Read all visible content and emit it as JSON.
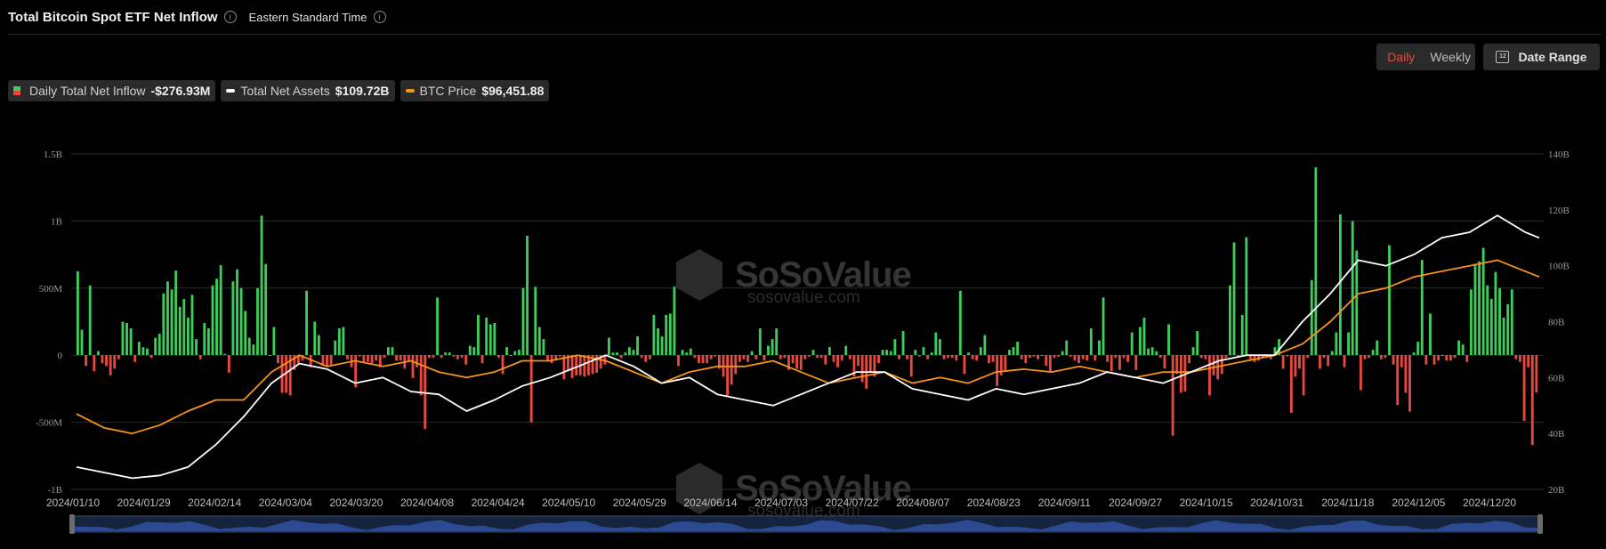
{
  "header": {
    "title": "Total Bitcoin Spot ETF Net Inflow",
    "timezone": "Eastern Standard Time",
    "period_toggle": {
      "daily": "Daily",
      "weekly": "Weekly",
      "selected": "Daily"
    },
    "date_range_label": "Date Range"
  },
  "legend": [
    {
      "label": "Daily Total Net Inflow",
      "value": "-$276.93M"
    },
    {
      "label": "Total Net Assets",
      "value": "$109.72B"
    },
    {
      "label": "BTC Price",
      "value": "$96,451.88"
    }
  ],
  "watermark": {
    "name": "SoSoValue",
    "url": "sosovalue.com"
  },
  "colors": {
    "inflow_positive": "#3ccd5a",
    "inflow_negative": "#e8483e",
    "net_assets": "#ffffff",
    "btc_price": "#f7931a",
    "grid": "#2b2b2b"
  },
  "chart_data": {
    "type": "bar",
    "x_tick_labels": [
      "2024/01/10",
      "2024/01/29",
      "2024/02/14",
      "2024/03/04",
      "2024/03/20",
      "2024/04/08",
      "2024/04/24",
      "2024/05/10",
      "2024/05/29",
      "2024/06/14",
      "2024/07/03",
      "2024/07/22",
      "2024/08/07",
      "2024/08/23",
      "2024/09/11",
      "2024/09/27",
      "2024/10/15",
      "2024/10/31",
      "2024/11/18",
      "2024/12/05",
      "2024/12/20"
    ],
    "y_left": {
      "ticks": [
        "1.5B",
        "1B",
        "500M",
        "0",
        "-500M",
        "-1B"
      ],
      "range": [
        -1000000000,
        1500000000
      ]
    },
    "y_right": {
      "ticks": [
        "140B",
        "120B",
        "100B",
        "80B",
        "60B",
        "40B",
        "20B"
      ],
      "range": [
        20,
        140
      ]
    },
    "series": [
      {
        "name": "Daily Total Net Inflow",
        "kind": "bar",
        "unit": "USD (millions)",
        "values": [
          625,
          190,
          -80,
          520,
          -120,
          30,
          -60,
          -80,
          -150,
          -100,
          -30,
          250,
          240,
          200,
          -50,
          100,
          60,
          50,
          -20,
          130,
          160,
          460,
          550,
          490,
          630,
          360,
          420,
          280,
          450,
          120,
          -30,
          240,
          200,
          520,
          570,
          670,
          10,
          -130,
          550,
          640,
          500,
          330,
          130,
          80,
          500,
          1040,
          680,
          0,
          210,
          -60,
          -280,
          -280,
          -300,
          -110,
          -60,
          -40,
          480,
          -90,
          250,
          150,
          -80,
          -80,
          -70,
          110,
          200,
          210,
          -30,
          -90,
          -240,
          -10,
          -50,
          -50,
          -60,
          -40,
          -90,
          -20,
          60,
          60,
          -40,
          -40,
          -100,
          -40,
          -170,
          -90,
          -300,
          -550,
          -20,
          -20,
          430,
          -20,
          20,
          20,
          -10,
          -30,
          -20,
          -70,
          70,
          60,
          300,
          -60,
          280,
          230,
          240,
          -20,
          -140,
          60,
          0,
          30,
          40,
          500,
          890,
          -500,
          510,
          210,
          120,
          -40,
          -60,
          -30,
          -10,
          -180,
          -120,
          -170,
          -150,
          -150,
          -160,
          -150,
          -140,
          -130,
          -100,
          -70,
          130,
          20,
          20,
          -20,
          20,
          60,
          40,
          140,
          -20,
          -50,
          -30,
          300,
          200,
          140,
          300,
          310,
          510,
          -80,
          40,
          20,
          50,
          -20,
          -60,
          -60,
          -60,
          -30,
          -10,
          -100,
          -160,
          -300,
          -220,
          -140,
          -50,
          -30,
          -50,
          30,
          -30,
          200,
          -40,
          70,
          120,
          200,
          -30,
          -20,
          -110,
          -60,
          -100,
          -110,
          -30,
          -10,
          40,
          -20,
          -20,
          -70,
          60,
          -50,
          -90,
          -40,
          70,
          -30,
          -160,
          -80,
          -200,
          -250,
          -130,
          -160,
          -60,
          40,
          40,
          30,
          120,
          -30,
          180,
          -30,
          -160,
          40,
          -10,
          60,
          -30,
          20,
          170,
          120,
          -30,
          -20,
          -20,
          -40,
          480,
          -140,
          20,
          -30,
          -40,
          60,
          150,
          -60,
          -50,
          -230,
          -150,
          -120,
          40,
          60,
          100,
          -30,
          -60,
          -20,
          -10,
          -30,
          0,
          -80,
          -120,
          -20,
          -10,
          30,
          110,
          -10,
          -40,
          -60,
          -30,
          -40,
          200,
          -40,
          110,
          430,
          -50,
          -120,
          -20,
          -110,
          -20,
          -50,
          170,
          -110,
          210,
          280,
          50,
          60,
          30,
          -20,
          -100,
          230,
          -600,
          -140,
          -280,
          -270,
          -60,
          60,
          180,
          -20,
          -30,
          -300,
          -150,
          -180,
          -140,
          -20,
          520,
          840,
          -10,
          300,
          880,
          -30,
          -50,
          -40,
          -20,
          -20,
          -30,
          60,
          120,
          -100,
          -10,
          -430,
          -160,
          -100,
          -300,
          -20,
          560,
          1400,
          -100,
          -20,
          -80,
          30,
          170,
          1050,
          -90,
          170,
          1000,
          780,
          -260,
          -30,
          -20,
          40,
          110,
          -30,
          -20,
          820,
          -70,
          -370,
          -90,
          -280,
          -420,
          20,
          100,
          710,
          -70,
          310,
          -70,
          -40,
          0,
          -40,
          -40,
          -20,
          110,
          80,
          -50,
          490,
          680,
          700,
          800,
          520,
          420,
          620,
          500,
          280,
          380,
          490,
          -30,
          -50,
          -490,
          -90,
          -670,
          -277
        ]
      },
      {
        "name": "Total Net Assets",
        "kind": "line",
        "unit": "USD (billions)",
        "points": [
          [
            0,
            28
          ],
          [
            6,
            26
          ],
          [
            12,
            24
          ],
          [
            18,
            25
          ],
          [
            24,
            28
          ],
          [
            30,
            36
          ],
          [
            36,
            46
          ],
          [
            42,
            58
          ],
          [
            48,
            65
          ],
          [
            54,
            63
          ],
          [
            60,
            58
          ],
          [
            66,
            60
          ],
          [
            72,
            55
          ],
          [
            78,
            54
          ],
          [
            84,
            48
          ],
          [
            90,
            52
          ],
          [
            96,
            57
          ],
          [
            102,
            60
          ],
          [
            108,
            64
          ],
          [
            114,
            68
          ],
          [
            120,
            64
          ],
          [
            126,
            58
          ],
          [
            132,
            60
          ],
          [
            138,
            54
          ],
          [
            144,
            52
          ],
          [
            150,
            50
          ],
          [
            156,
            54
          ],
          [
            162,
            58
          ],
          [
            168,
            62
          ],
          [
            174,
            62
          ],
          [
            180,
            56
          ],
          [
            186,
            54
          ],
          [
            192,
            52
          ],
          [
            198,
            56
          ],
          [
            204,
            54
          ],
          [
            210,
            56
          ],
          [
            216,
            58
          ],
          [
            222,
            62
          ],
          [
            228,
            60
          ],
          [
            234,
            58
          ],
          [
            240,
            62
          ],
          [
            246,
            66
          ],
          [
            252,
            68
          ],
          [
            258,
            68
          ],
          [
            264,
            80
          ],
          [
            270,
            90
          ],
          [
            276,
            102
          ],
          [
            282,
            100
          ],
          [
            288,
            104
          ],
          [
            294,
            110
          ],
          [
            300,
            112
          ],
          [
            306,
            118
          ],
          [
            312,
            112
          ],
          [
            315,
            110
          ]
        ]
      },
      {
        "name": "BTC Price",
        "kind": "line",
        "unit": "USD (thousands)",
        "points": [
          [
            0,
            47
          ],
          [
            6,
            42
          ],
          [
            12,
            40
          ],
          [
            18,
            43
          ],
          [
            24,
            48
          ],
          [
            30,
            52
          ],
          [
            36,
            52
          ],
          [
            42,
            62
          ],
          [
            48,
            68
          ],
          [
            54,
            64
          ],
          [
            60,
            66
          ],
          [
            66,
            64
          ],
          [
            72,
            66
          ],
          [
            78,
            62
          ],
          [
            84,
            60
          ],
          [
            90,
            62
          ],
          [
            96,
            66
          ],
          [
            102,
            66
          ],
          [
            108,
            68
          ],
          [
            114,
            66
          ],
          [
            120,
            62
          ],
          [
            126,
            58
          ],
          [
            132,
            62
          ],
          [
            138,
            64
          ],
          [
            144,
            64
          ],
          [
            150,
            66
          ],
          [
            156,
            62
          ],
          [
            162,
            58
          ],
          [
            168,
            60
          ],
          [
            174,
            62
          ],
          [
            180,
            58
          ],
          [
            186,
            60
          ],
          [
            192,
            58
          ],
          [
            198,
            62
          ],
          [
            204,
            63
          ],
          [
            210,
            62
          ],
          [
            216,
            64
          ],
          [
            222,
            62
          ],
          [
            228,
            60
          ],
          [
            234,
            62
          ],
          [
            240,
            62
          ],
          [
            246,
            64
          ],
          [
            252,
            66
          ],
          [
            258,
            68
          ],
          [
            264,
            72
          ],
          [
            270,
            80
          ],
          [
            276,
            90
          ],
          [
            282,
            92
          ],
          [
            288,
            96
          ],
          [
            294,
            98
          ],
          [
            300,
            100
          ],
          [
            306,
            102
          ],
          [
            312,
            98
          ],
          [
            315,
            96
          ]
        ]
      }
    ],
    "grid": true,
    "legend_position": "top-left"
  }
}
